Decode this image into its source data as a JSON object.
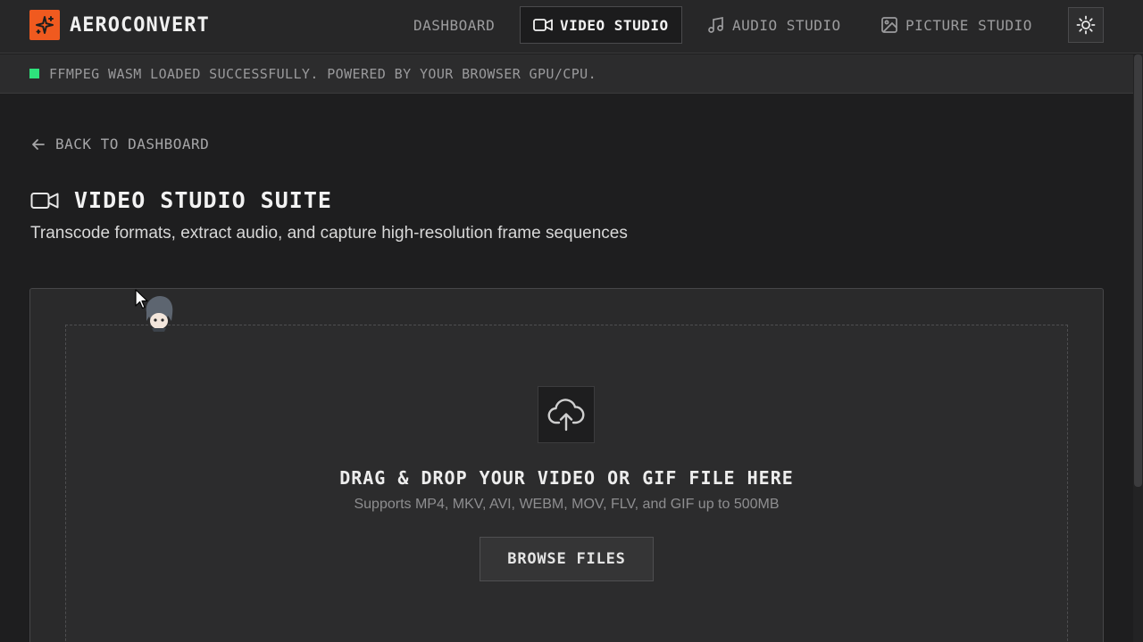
{
  "app": {
    "name": "AEROCONVERT",
    "accent_color": "#f05a1f"
  },
  "nav": {
    "items": [
      {
        "label": "DASHBOARD",
        "icon": "none",
        "active": false
      },
      {
        "label": "VIDEO STUDIO",
        "icon": "video-camera-icon",
        "active": true
      },
      {
        "label": "AUDIO STUDIO",
        "icon": "music-note-icon",
        "active": false
      },
      {
        "label": "PICTURE STUDIO",
        "icon": "image-icon",
        "active": false
      }
    ],
    "theme_toggle_icon": "sun-icon"
  },
  "status": {
    "text": "FFMPEG WASM LOADED SUCCESSFULLY. POWERED BY YOUR BROWSER GPU/CPU.",
    "indicator_color": "#2ee37c"
  },
  "page": {
    "back_label": "BACK TO DASHBOARD",
    "title": "VIDEO STUDIO SUITE",
    "subtitle": "Transcode formats, extract audio, and capture high-resolution frame sequences"
  },
  "upload": {
    "icon": "cloud-upload-icon",
    "title": "DRAG & DROP YOUR VIDEO OR GIF FILE HERE",
    "subtitle": "Supports MP4, MKV, AVI, WEBM, MOV, FLV, and GIF up to 500MB",
    "button_label": "BROWSE FILES"
  }
}
